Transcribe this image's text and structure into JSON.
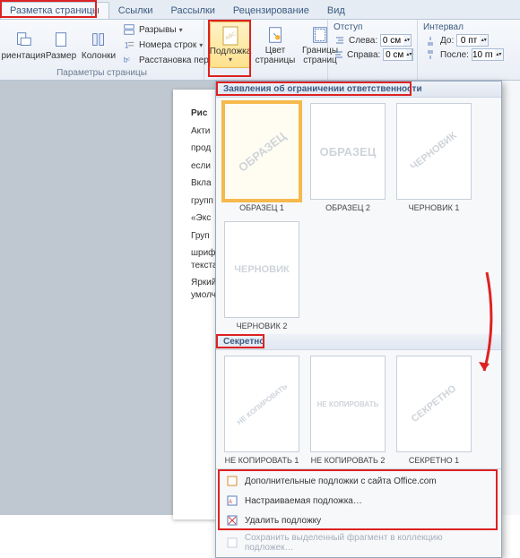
{
  "tabs": {
    "active": "Разметка страницы",
    "items": [
      "Разметка страницы",
      "Ссылки",
      "Рассылки",
      "Рецензирование",
      "Вид"
    ]
  },
  "ribbon": {
    "group_params": "Параметры страницы",
    "orientation": "риентация",
    "size": "Размер",
    "columns": "Колонки",
    "breaks": "Разрывы",
    "line_numbers": "Номера строк",
    "hyphenation": "Расстановка переносов",
    "watermark": "Подложка",
    "page_color": "Цвет\nстраницы",
    "page_borders": "Границы\nстраниц",
    "indent_group": "Отступ",
    "indent_left_label": "Слева:",
    "indent_right_label": "Справа:",
    "indent_left": "0 см",
    "indent_right": "0 см",
    "spacing_group": "Интервал",
    "spacing_before_label": "До:",
    "spacing_after_label": "После:",
    "spacing_before": "0 пт",
    "spacing_after": "10 пт"
  },
  "watermark_popup": {
    "section1": "Заявления об ограничении ответственности",
    "section2": "Секретно",
    "thumbs1": [
      {
        "wm": "ОБРАЗЕЦ",
        "label": "ОБРАЗЕЦ 1"
      },
      {
        "wm": "ОБРАЗЕЦ",
        "label": "ОБРАЗЕЦ 2"
      },
      {
        "wm": "ЧЕРНОВИК",
        "label": "ЧЕРНОВИК 1"
      },
      {
        "wm": "ЧЕРНОВИК",
        "label": "ЧЕРНОВИК 2"
      }
    ],
    "thumbs2": [
      {
        "wm": "НЕ КОПИРОВАТЬ",
        "label": "НЕ КОПИРОВАТЬ 1"
      },
      {
        "wm": "НЕ КОПИРОВАТЬ",
        "label": "НЕ КОПИРОВАТЬ 2"
      },
      {
        "wm": "СЕКРЕТНО",
        "label": "СЕКРЕТНО 1"
      }
    ],
    "menu_office": "Дополнительные подложки с сайта Office.com",
    "menu_custom": "Настраиваемая подложка…",
    "menu_remove": "Удалить подложку",
    "menu_save_sel": "Сохранить выделенный фрагмент в коллекцию подложек…"
  },
  "doc": {
    "p1": "Рис",
    "p2": "Акти",
    "p3": "прод",
    "p4": "если",
    "p5": "Вкла",
    "p6": "групп",
    "p7": "«Экс",
    "p8": "Груп",
    "p9": "шрифт» и «курсив» поскольку они относятся к форматированию текста, в частности шри",
    "p10": "Яркий пример этого - вкладка «Шрифт» с набором команд по умолчанию."
  }
}
